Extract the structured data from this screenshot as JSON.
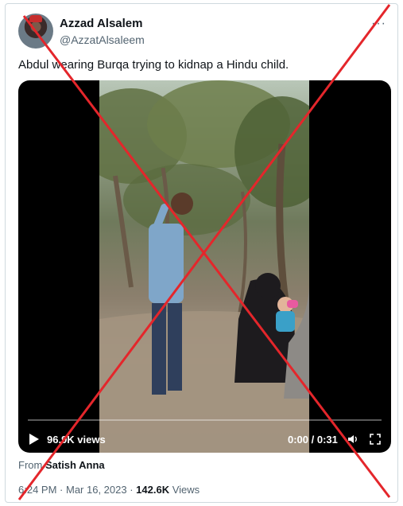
{
  "author": {
    "name": "Azzad Alsalem",
    "handle": "@AzzatAlsaleem"
  },
  "tweet": {
    "text": "Abdul wearing Burqa trying to kidnap a Hindu child."
  },
  "video": {
    "views": "96.9K views",
    "time": "0:00 / 0:31"
  },
  "from": {
    "prefix": "From",
    "name": "Satish Anna"
  },
  "meta": {
    "time": "6:24 PM",
    "sep": " · ",
    "date": "Mar 16, 2023",
    "views_count": "142.6K",
    "views_label": "Views"
  },
  "icons": [
    "more-icon",
    "play-icon",
    "volume-icon",
    "fullscreen-icon"
  ],
  "colors": {
    "cross": "#e4262b",
    "secondary_text": "#536471",
    "border": "#cfd9de"
  }
}
